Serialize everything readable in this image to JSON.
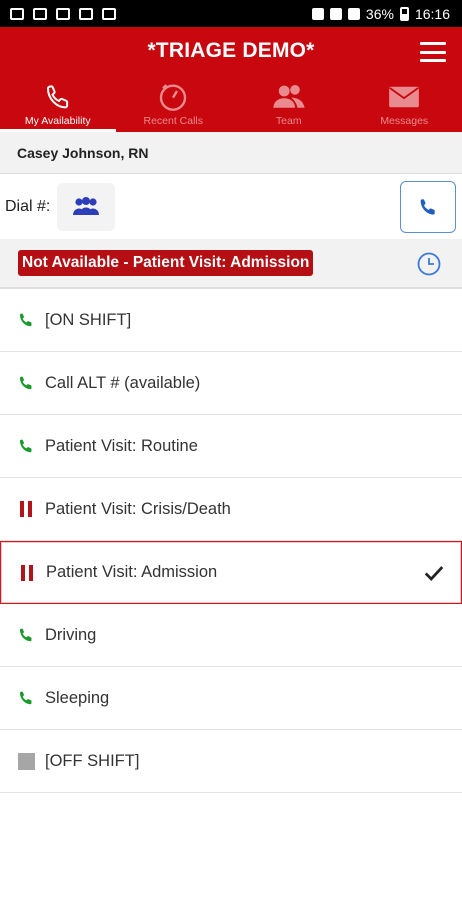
{
  "status_bar": {
    "battery": "36%",
    "time": "16:16"
  },
  "app": {
    "title": "*TRIAGE DEMO*",
    "accent_color": "#c8070e"
  },
  "tabs": [
    {
      "label": "My Availability",
      "icon": "phone-icon",
      "active": true
    },
    {
      "label": "Recent Calls",
      "icon": "timer-icon",
      "active": false
    },
    {
      "label": "Team",
      "icon": "team-icon",
      "active": false
    },
    {
      "label": "Messages",
      "icon": "envelope-icon",
      "active": false
    }
  ],
  "user": {
    "name": "Casey Johnson, RN"
  },
  "dial": {
    "label": "Dial #:",
    "group_icon": "group-icon",
    "call_icon": "phone-icon"
  },
  "current_status": {
    "label": "Not Available - Patient Visit: Admission",
    "history_icon": "clock-icon"
  },
  "statuses": [
    {
      "label": "[ON SHIFT]",
      "icon": "phone-green-icon",
      "selected": false
    },
    {
      "label": "Call ALT # (available)",
      "icon": "phone-green-icon",
      "selected": false
    },
    {
      "label": "Patient Visit: Routine",
      "icon": "phone-green-icon",
      "selected": false
    },
    {
      "label": "Patient Visit: Crisis/Death",
      "icon": "pause-red-icon",
      "selected": false
    },
    {
      "label": "Patient Visit: Admission",
      "icon": "pause-red-icon",
      "selected": true
    },
    {
      "label": "Driving",
      "icon": "phone-green-icon",
      "selected": false
    },
    {
      "label": "Sleeping",
      "icon": "phone-green-icon",
      "selected": false
    },
    {
      "label": "[OFF SHIFT]",
      "icon": "gray-square-icon",
      "selected": false
    }
  ]
}
